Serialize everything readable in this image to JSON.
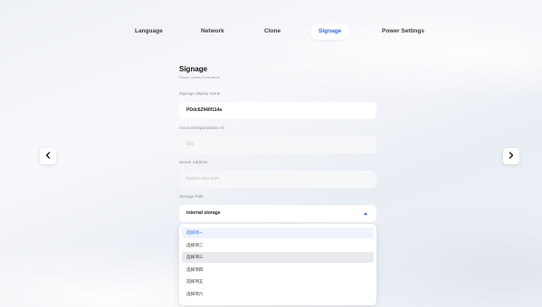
{
  "tabs": [
    {
      "label": "Language"
    },
    {
      "label": "Network"
    },
    {
      "label": "Clone"
    },
    {
      "label": "Signage",
      "active": true
    },
    {
      "label": "Power Settings"
    }
  ],
  "nav": {
    "prev_icon": "‹",
    "next_icon": "›"
  },
  "signage": {
    "title": "Signage",
    "subtitle": "Please connect to the server",
    "display_name": {
      "label": "Signage display name",
      "value": "PDdc62940f114a"
    },
    "account_id": {
      "label": "Account/Organization ID",
      "value": "001"
    },
    "server_address": {
      "label": "Server Address",
      "value": "kyamo.vina.com"
    },
    "storage_path": {
      "label": "Storage Path",
      "value": "internal storage"
    }
  },
  "dropdown": {
    "options": [
      "选择项一",
      "选择项二",
      "选择项三",
      "选择项四",
      "选择项五",
      "选择项六"
    ],
    "selected_index": 0,
    "hover_index": 2
  },
  "colors": {
    "accent": "#2a6df4",
    "background": "#f1f3f7",
    "card": "#ffffff"
  }
}
